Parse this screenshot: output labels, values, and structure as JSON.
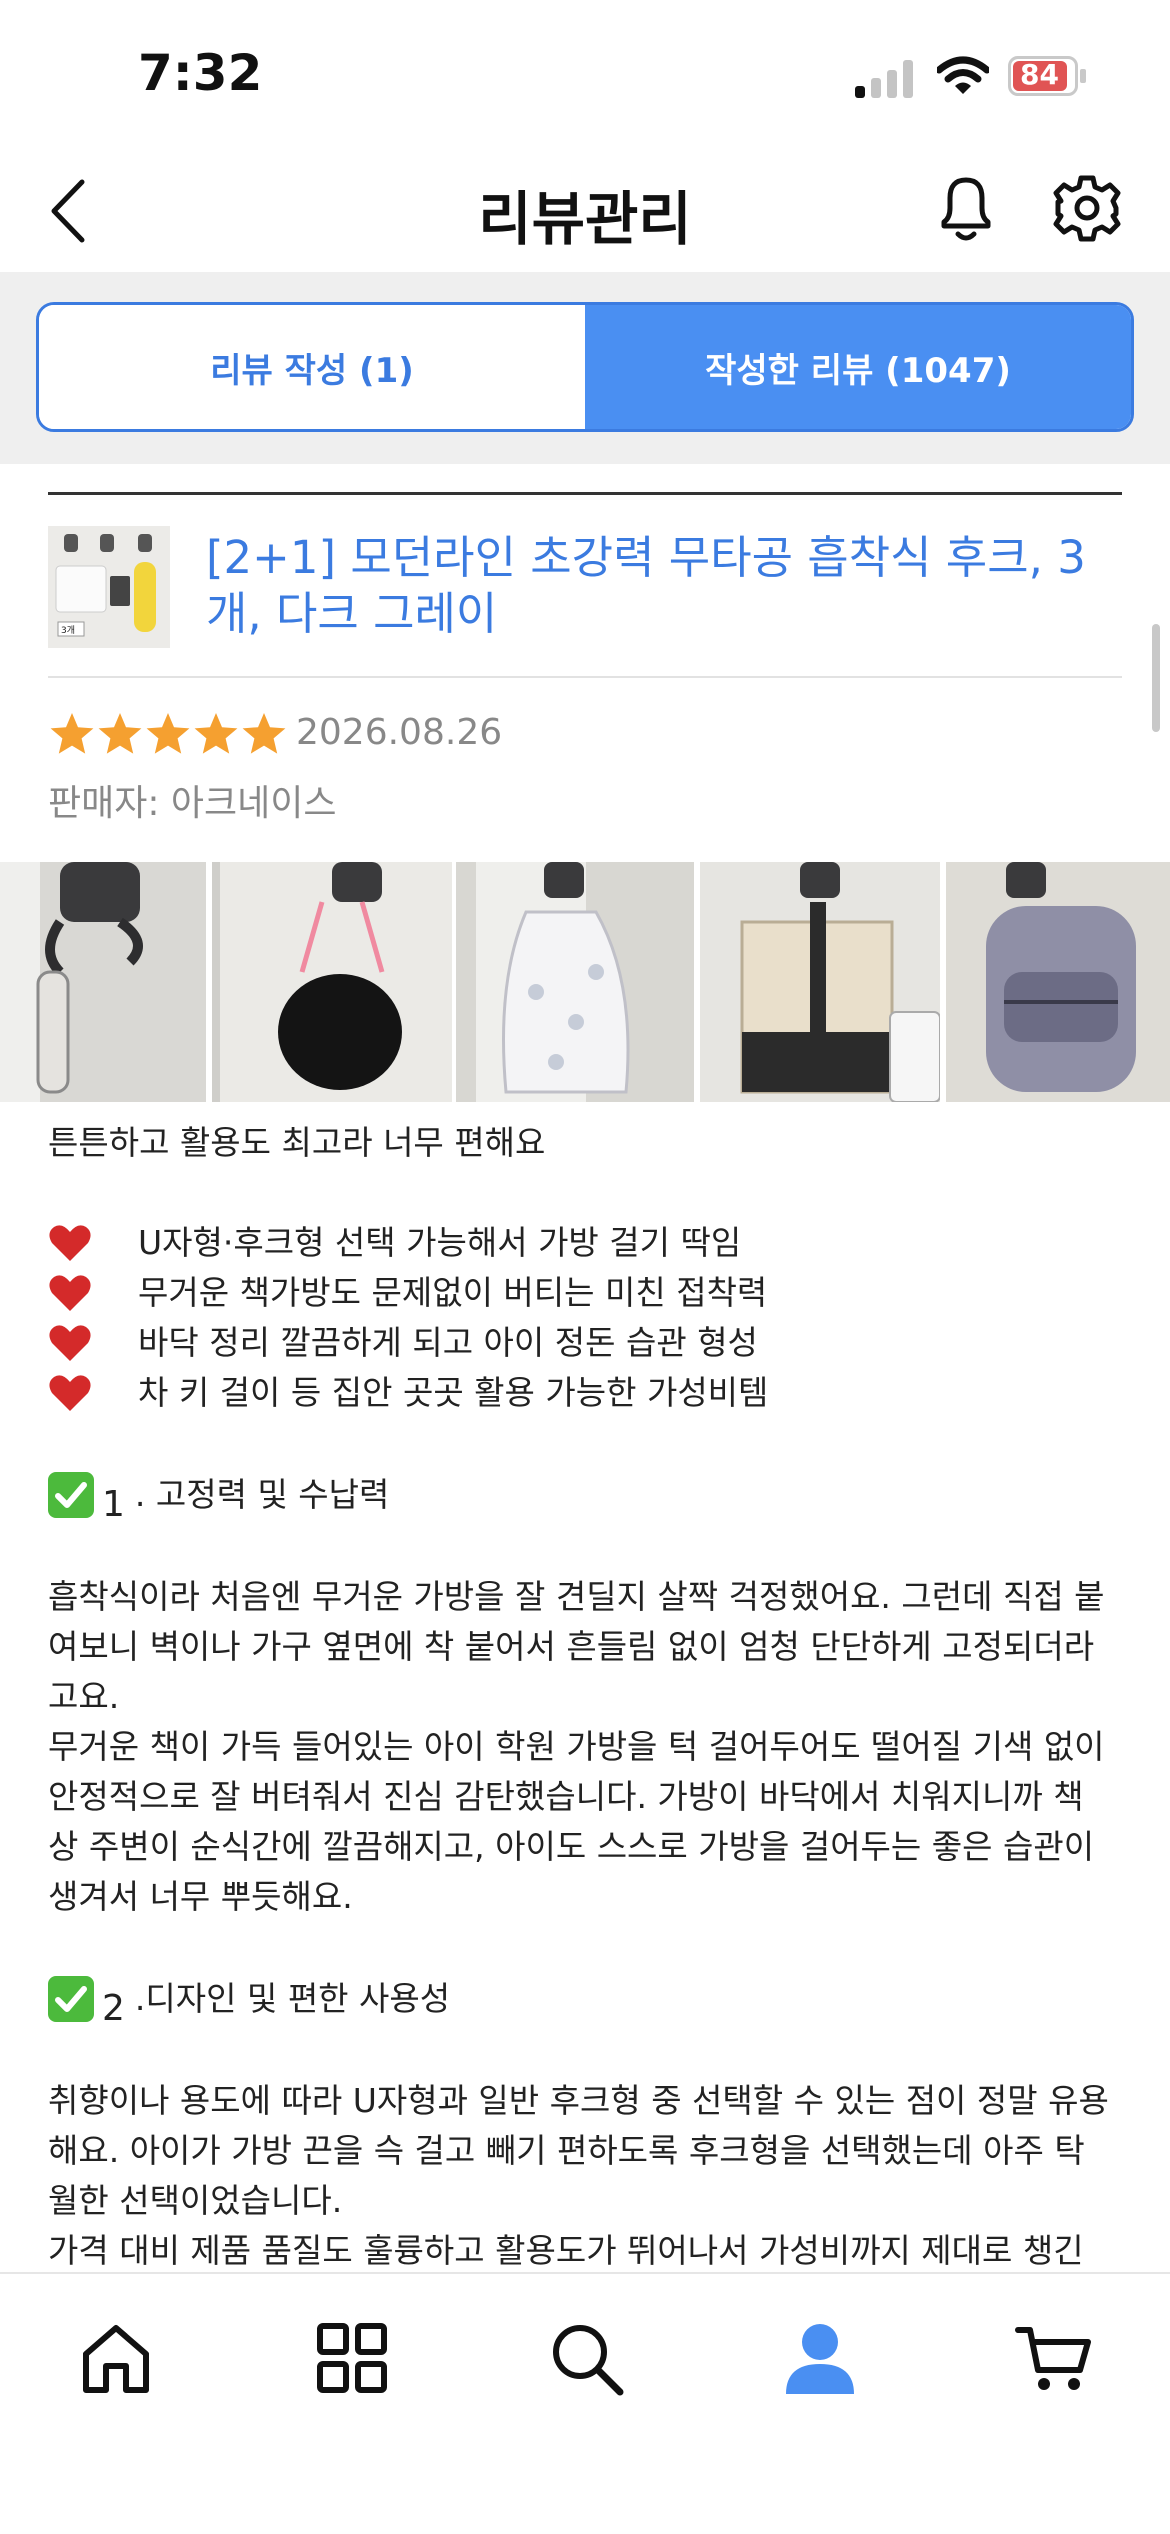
{
  "status_bar": {
    "time": "7:32",
    "battery": "84"
  },
  "header": {
    "title": "리뷰관리"
  },
  "tabs": [
    {
      "label": "리뷰 작성 (1)",
      "active": false
    },
    {
      "label": "작성한 리뷰 (1047)",
      "active": true
    }
  ],
  "product": {
    "title": "[2+1] 모던라인 초강력 무타공 흡착식 후크, 3개, 다크 그레이",
    "thumb_badge": "3개"
  },
  "review": {
    "rating": 5,
    "date": "2026.08.26",
    "seller": "판매자: 아크네이스",
    "headline": "튼튼하고 활용도 최고라 너무 편해요",
    "bullets": [
      "U자형·후크형 선택 가능해서 가방 걸기 딱임",
      "무거운 책가방도 문제없이 버티는 미친 접착력",
      "바닥 정리 깔끔하게 되고 아이 정돈 습관 형성",
      "차 키 걸이 등 집안 곳곳 활용 가능한 가성비템"
    ],
    "sections": [
      {
        "num": "1",
        "title": ". 고정력 및 수납력",
        "p1_line1": "흡착식이라 처음엔 무거운 가방을 잘 견딜지 살짝 걱정했어요. 그런데 직접 붙",
        "p1_line2": "여보니 벽이나 가구 옆면에 착 붙어서 흔들림 없이 엄청 단단하게 고정되더라",
        "p1_line3": "고요.",
        "p2_line1": "무거운 책이 가득 들어있는 아이 학원 가방을 턱 걸어두어도 떨어질 기색 없이",
        "p2_line2": "안정적으로 잘 버텨줘서 진심 감탄했습니다. 가방이 바닥에서 치워지니까 책",
        "p2_line3": "상 주변이 순식간에 깔끔해지고, 아이도 스스로 가방을 걸어두는 좋은 습관이",
        "p2_line4": "생겨서 너무 뿌듯해요."
      },
      {
        "num": "2",
        "title": ".디자인 및 편한 사용성",
        "p1_line1": "취향이나 용도에 따라 U자형과 일반 후크형 중 선택할 수 있는 점이 정말 유용",
        "p1_line2": "해요. 아이가 가방 끈을 슥 걸고 빼기 편하도록 후크형을 선택했는데 아주 탁",
        "p1_line3": "월한 선택이었습니다.",
        "p2_line1": "가격 대비 제품 품질도 훌륭하고 활용도가 뛰어나서 가성비까지 제대로 챙긴"
      }
    ]
  },
  "colors": {
    "accent": "#3b7be0",
    "tab_active": "#4a8ff2",
    "star": "#f5a030",
    "heart": "#d42a2a",
    "check": "#4cba3c"
  },
  "bottom_nav": [
    {
      "icon": "home-icon"
    },
    {
      "icon": "grid-icon"
    },
    {
      "icon": "search-icon"
    },
    {
      "icon": "user-icon",
      "active": true
    },
    {
      "icon": "cart-icon"
    }
  ]
}
